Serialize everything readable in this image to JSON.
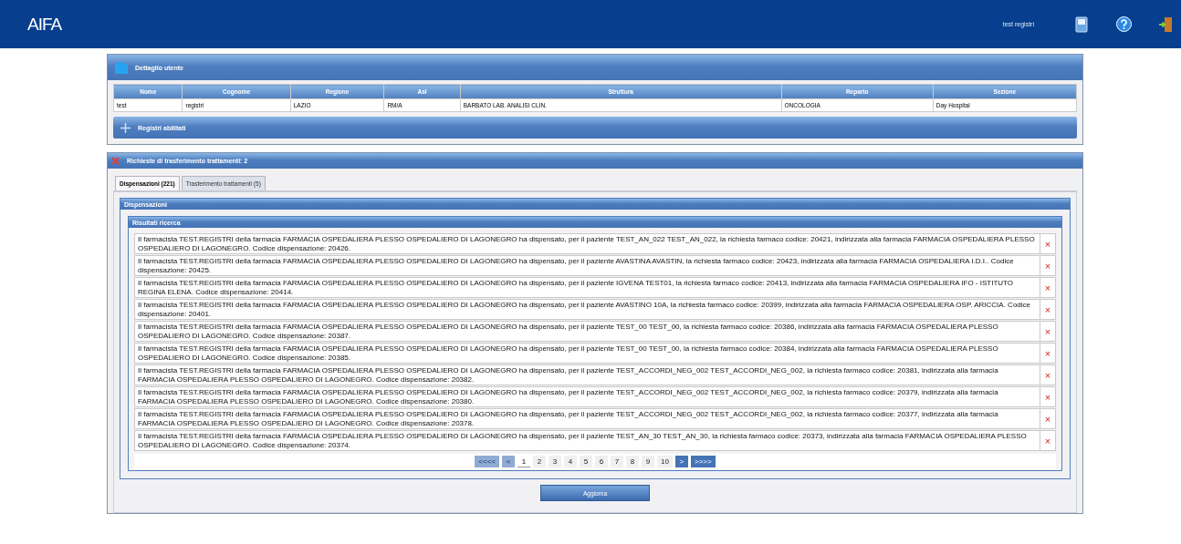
{
  "header": {
    "logo": "AIFA",
    "user": "test registri"
  },
  "user_panel": {
    "title": "Dettaglio utente",
    "columns": [
      "Nome",
      "Cognome",
      "Regione",
      "Asl",
      "Struttura",
      "Reparto",
      "Sezione"
    ],
    "row": [
      "test",
      "registri",
      "LAZIO",
      "RM/A",
      "BARBATO LAB. ANALISI CLIN.",
      "ONCOLOGIA",
      "Day Hospital"
    ],
    "registri": {
      "title": "Registri abilitati",
      "expanded": false
    }
  },
  "requests_panel": {
    "title": "Richieste di trasferimento trattamenti: 2",
    "tabs": [
      {
        "label": "Dispensazioni (221)",
        "selected": true
      },
      {
        "label": "Trasferimento trattamenti (5)",
        "selected": false
      }
    ],
    "section_title": "Dispensazioni",
    "results_title": "Risultati ricerca",
    "messages": [
      "Il farmacista TEST.REGISTRI della farmacia FARMACIA OSPEDALIERA PLESSO OSPEDALIERO DI LAGONEGRO ha dispensato, per il paziente TEST_AN_022 TEST_AN_022, la richiesta farmaco codice: 20421, indirizzata alla farmacia FARMACIA OSPEDALIERA PLESSO OSPEDALIERO DI LAGONEGRO. Codice dispensazione: 20426.",
      "Il farmacista TEST.REGISTRI della farmacia FARMACIA OSPEDALIERA PLESSO OSPEDALIERO DI LAGONEGRO ha dispensato, per il paziente AVASTINA AVASTIN, la richiesta farmaco codice: 20423, indirizzata alla farmacia FARMACIA OSPEDALIERA I.D.I.. Codice dispensazione: 20425.",
      "Il farmacista TEST.REGISTRI della farmacia FARMACIA OSPEDALIERA PLESSO OSPEDALIERO DI LAGONEGRO ha dispensato, per il paziente IGVENA TEST01, la richiesta farmaco codice: 20413, indirizzata alla farmacia FARMACIA OSPEDALIERA IFO - ISTITUTO REGINA ELENA. Codice dispensazione: 20414.",
      "Il farmacista TEST.REGISTRI della farmacia FARMACIA OSPEDALIERA PLESSO OSPEDALIERO DI LAGONEGRO ha dispensato, per il paziente AVASTINO 10A, la richiesta farmaco codice: 20399, indirizzata alla farmacia FARMACIA OSPEDALIERA OSP. ARICCIA. Codice dispensazione: 20401.",
      "Il farmacista TEST.REGISTRI della farmacia FARMACIA OSPEDALIERA PLESSO OSPEDALIERO DI LAGONEGRO ha dispensato, per il paziente TEST_00 TEST_00, la richiesta farmaco codice: 20386, indirizzata alla farmacia FARMACIA OSPEDALIERA PLESSO OSPEDALIERO DI LAGONEGRO. Codice dispensazione: 20387.",
      "Il farmacista TEST.REGISTRI della farmacia FARMACIA OSPEDALIERA PLESSO OSPEDALIERO DI LAGONEGRO ha dispensato, per il paziente TEST_00 TEST_00, la richiesta farmaco codice: 20384, indirizzata alla farmacia FARMACIA OSPEDALIERA PLESSO OSPEDALIERO DI LAGONEGRO. Codice dispensazione: 20385.",
      "Il farmacista TEST.REGISTRI della farmacia FARMACIA OSPEDALIERA PLESSO OSPEDALIERO DI LAGONEGRO ha dispensato, per il paziente TEST_ACCORDI_NEG_002 TEST_ACCORDI_NEG_002, la richiesta farmaco codice: 20381, indirizzata alla farmacia FARMACIA OSPEDALIERA PLESSO OSPEDALIERO DI LAGONEGRO. Codice dispensazione: 20382.",
      "Il farmacista TEST.REGISTRI della farmacia FARMACIA OSPEDALIERA PLESSO OSPEDALIERO DI LAGONEGRO ha dispensato, per il paziente TEST_ACCORDI_NEG_002 TEST_ACCORDI_NEG_002, la richiesta farmaco codice: 20379, indirizzata alla farmacia FARMACIA OSPEDALIERA PLESSO OSPEDALIERO DI LAGONEGRO. Codice dispensazione: 20380.",
      "Il farmacista TEST.REGISTRI della farmacia FARMACIA OSPEDALIERA PLESSO OSPEDALIERO DI LAGONEGRO ha dispensato, per il paziente TEST_ACCORDI_NEG_002 TEST_ACCORDI_NEG_002, la richiesta farmaco codice: 20377, indirizzata alla farmacia FARMACIA OSPEDALIERA PLESSO OSPEDALIERO DI LAGONEGRO. Codice dispensazione: 20378.",
      "Il farmacista TEST.REGISTRI della farmacia FARMACIA OSPEDALIERA PLESSO OSPEDALIERO DI LAGONEGRO ha dispensato, per il paziente TEST_AN_30 TEST_AN_30, la richiesta farmaco codice: 20373, indirizzata alla farmacia FARMACIA OSPEDALIERA PLESSO OSPEDALIERO DI LAGONEGRO. Codice dispensazione: 20374."
    ],
    "delete_mark": "×",
    "pagination": [
      {
        "label": "<<<<",
        "kind": "nav",
        "disabled": true,
        "selected": false
      },
      {
        "label": "<",
        "kind": "nav",
        "disabled": true,
        "selected": false
      },
      {
        "label": "1",
        "kind": "page",
        "disabled": false,
        "selected": true
      },
      {
        "label": "2",
        "kind": "page",
        "disabled": false,
        "selected": false
      },
      {
        "label": "3",
        "kind": "page",
        "disabled": false,
        "selected": false
      },
      {
        "label": "4",
        "kind": "page",
        "disabled": false,
        "selected": false
      },
      {
        "label": "5",
        "kind": "page",
        "disabled": false,
        "selected": false
      },
      {
        "label": "6",
        "kind": "page",
        "disabled": false,
        "selected": false
      },
      {
        "label": "7",
        "kind": "page",
        "disabled": false,
        "selected": false
      },
      {
        "label": "8",
        "kind": "page",
        "disabled": false,
        "selected": false
      },
      {
        "label": "9",
        "kind": "page",
        "disabled": false,
        "selected": false
      },
      {
        "label": "10",
        "kind": "page",
        "disabled": false,
        "selected": false
      },
      {
        "label": ">",
        "kind": "nav",
        "disabled": false,
        "selected": false
      },
      {
        "label": ">>>>",
        "kind": "nav",
        "disabled": false,
        "selected": false
      }
    ],
    "refresh_button": "Aggiorna"
  }
}
